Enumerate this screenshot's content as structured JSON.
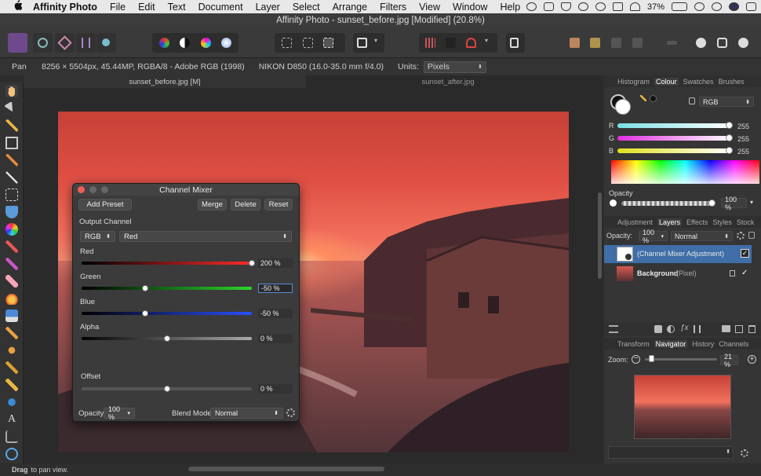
{
  "menubar": {
    "app_name": "Affinity Photo",
    "items": [
      "File",
      "Edit",
      "Text",
      "Document",
      "Layer",
      "Select",
      "Arrange",
      "Filters",
      "View",
      "Window",
      "Help"
    ],
    "battery": "37%"
  },
  "window": {
    "title": "Affinity Photo - sunset_before.jpg [Modified] (20.8%)"
  },
  "context_bar": {
    "tool": "Pan",
    "image_info": "8256 × 5504px, 45.44MP, RGBA/8 - Adobe RGB (1998)",
    "camera": "NIKON D850 (16.0-35.0 mm f/4.0)",
    "units_label": "Units:",
    "units_value": "Pixels"
  },
  "tabs": [
    {
      "label": "sunset_before.jpg [M]",
      "active": true
    },
    {
      "label": "sunset_after.jpg",
      "active": false
    }
  ],
  "dialog": {
    "title": "Channel Mixer",
    "buttons": {
      "add_preset": "Add Preset",
      "merge": "Merge",
      "delete": "Delete",
      "reset": "Reset"
    },
    "output_channel_label": "Output Channel",
    "color_model": "RGB",
    "channel": "Red",
    "sliders": [
      {
        "label": "Red",
        "value": "200 %",
        "position": 1.0
      },
      {
        "label": "Green",
        "value": "-50 %",
        "position": 0.375
      },
      {
        "label": "Blue",
        "value": "-50 %",
        "position": 0.375
      },
      {
        "label": "Alpha",
        "value": "0 %",
        "position": 0.5
      }
    ],
    "offset": {
      "label": "Offset",
      "value": "0 %",
      "position": 0.5
    },
    "opacity_label": "Opacity:",
    "opacity_value": "100 %",
    "blend_label": "Blend Mode:",
    "blend_value": "Normal"
  },
  "colour_panel": {
    "tabs": [
      "Histogram",
      "Colour",
      "Swatches",
      "Brushes"
    ],
    "active_tab": "Colour",
    "model": "RGB",
    "r_label": "R",
    "r_value": "255",
    "g_label": "G",
    "g_value": "255",
    "b_label": "B",
    "b_value": "255",
    "opacity_label": "Opacity",
    "opacity_value": "100 %"
  },
  "layers_panel": {
    "tabs": [
      "Adjustment",
      "Layers",
      "Effects",
      "Styles",
      "Stock"
    ],
    "active_tab": "Layers",
    "opacity_label": "Opacity:",
    "opacity_value": "100 %",
    "blend_value": "Normal",
    "layers": [
      {
        "name": "(Channel Mixer Adjustment)",
        "type": "",
        "selected": true
      },
      {
        "name": "Background",
        "type": "(Pixel)",
        "selected": false
      }
    ]
  },
  "navigator_panel": {
    "tabs": [
      "Transform",
      "Navigator",
      "History",
      "Channels"
    ],
    "active_tab": "Navigator",
    "zoom_label": "Zoom:",
    "zoom_value": "21 %"
  },
  "status": {
    "bold": "Drag",
    "text": "to pan view."
  }
}
